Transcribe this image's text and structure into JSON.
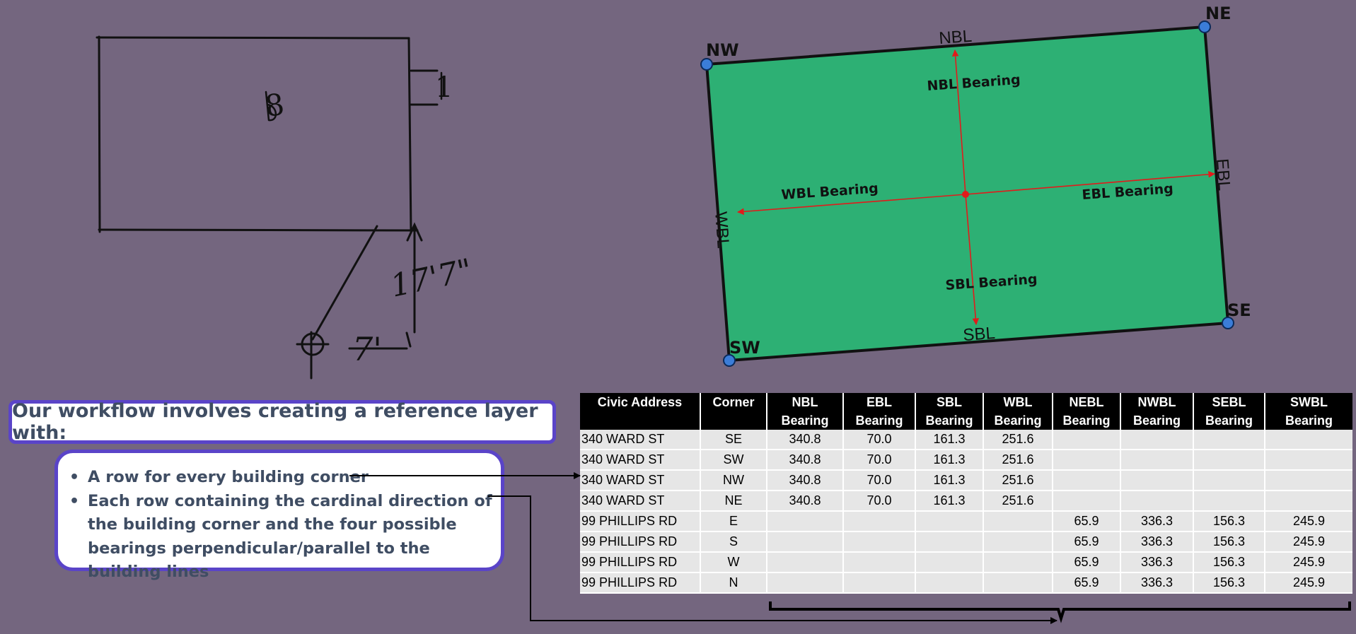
{
  "sketch": {
    "number_label": "8",
    "side_label": "1",
    "distance_vertical": "17'7\"",
    "distance_horizontal": "7'"
  },
  "diagram": {
    "fill_color": "#2db074",
    "corner_color": "#3b7dd8",
    "arrow_color": "#e11b1b",
    "corners": {
      "nw": "NW",
      "ne": "NE",
      "se": "SE",
      "sw": "SW"
    },
    "edges": {
      "north": "NBL",
      "east": "EBL",
      "south": "SBL",
      "west": "WBL"
    },
    "bearings": {
      "north": "NBL Bearing",
      "east": "EBL Bearing",
      "south": "SBL Bearing",
      "west": "WBL Bearing"
    }
  },
  "workflow": {
    "title": "Our workflow involves creating a reference layer with:",
    "bullets": [
      "A row for every building corner",
      "Each row containing the cardinal direction of the building corner and the four possible bearings perpendicular/parallel to the building lines"
    ]
  },
  "table": {
    "headers": [
      "Civic Address",
      "Corner",
      "NBL Bearing",
      "EBL Bearing",
      "SBL Bearing",
      "WBL Bearing",
      "NEBL Bearing",
      "NWBL Bearing",
      "SEBL Bearing",
      "SWBL Bearing"
    ],
    "rows": [
      [
        "340 WARD ST",
        "SE",
        "340.8",
        "70.0",
        "161.3",
        "251.6",
        "",
        "",
        "",
        ""
      ],
      [
        "340 WARD ST",
        "SW",
        "340.8",
        "70.0",
        "161.3",
        "251.6",
        "",
        "",
        "",
        ""
      ],
      [
        "340 WARD ST",
        "NW",
        "340.8",
        "70.0",
        "161.3",
        "251.6",
        "",
        "",
        "",
        ""
      ],
      [
        "340 WARD ST",
        "NE",
        "340.8",
        "70.0",
        "161.3",
        "251.6",
        "",
        "",
        "",
        ""
      ],
      [
        "99 PHILLIPS RD",
        "E",
        "",
        "",
        "",
        "",
        "65.9",
        "336.3",
        "156.3",
        "245.9"
      ],
      [
        "99 PHILLIPS RD",
        "S",
        "",
        "",
        "",
        "",
        "65.9",
        "336.3",
        "156.3",
        "245.9"
      ],
      [
        "99 PHILLIPS RD",
        "W",
        "",
        "",
        "",
        "",
        "65.9",
        "336.3",
        "156.3",
        "245.9"
      ],
      [
        "99 PHILLIPS RD",
        "N",
        "",
        "",
        "",
        "",
        "65.9",
        "336.3",
        "156.3",
        "245.9"
      ]
    ]
  }
}
